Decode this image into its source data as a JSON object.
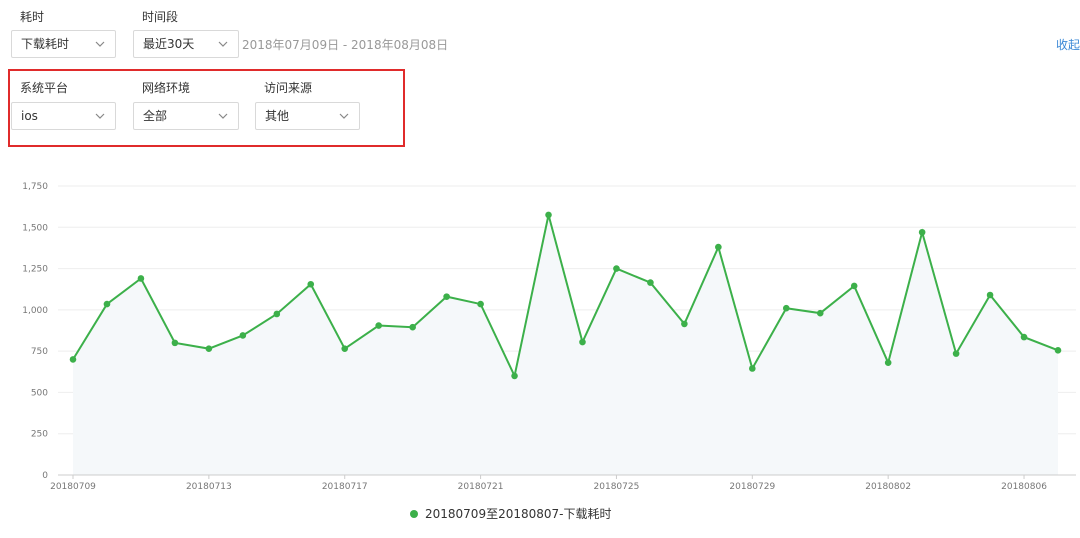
{
  "filters": {
    "duration": {
      "label": "耗时",
      "value": "下载耗时"
    },
    "period": {
      "label": "时间段",
      "value": "最近30天"
    },
    "date_range": "2018年07月09日 - 2018年08月08日",
    "collapse": "收起",
    "platform": {
      "label": "系统平台",
      "value": "ios"
    },
    "network": {
      "label": "网络环境",
      "value": "全部"
    },
    "source": {
      "label": "访问来源",
      "value": "其他"
    }
  },
  "icons": {
    "select_arrow": "chevron-down-icon"
  },
  "colors": {
    "series": "#3cb04a",
    "area": "#f5f8fa",
    "highlight_box": "#e02b2b",
    "link": "#3b88d6"
  },
  "chart_data": {
    "type": "line",
    "title": "",
    "xlabel": "",
    "ylabel": "",
    "x": [
      "20180709",
      "20180710",
      "20180711",
      "20180712",
      "20180713",
      "20180714",
      "20180715",
      "20180716",
      "20180717",
      "20180718",
      "20180719",
      "20180720",
      "20180721",
      "20180722",
      "20180723",
      "20180724",
      "20180725",
      "20180726",
      "20180727",
      "20180728",
      "20180729",
      "20180730",
      "20180731",
      "20180801",
      "20180802",
      "20180803",
      "20180804",
      "20180805",
      "20180806",
      "20180807"
    ],
    "x_tick_labels": [
      "20180709",
      "20180713",
      "20180717",
      "20180721",
      "20180725",
      "20180729",
      "20180802",
      "20180806"
    ],
    "y_ticks": [
      "0",
      "250",
      "500",
      "750",
      "1,000",
      "1,250",
      "1,500",
      "1,750"
    ],
    "ylim": [
      0,
      1750
    ],
    "grid": true,
    "legend_position": "bottom",
    "series": [
      {
        "name": "20180709至20180807-下载耗时",
        "values": [
          700,
          1035,
          1190,
          800,
          765,
          845,
          975,
          1155,
          765,
          905,
          895,
          1080,
          1035,
          600,
          1575,
          805,
          1250,
          1165,
          915,
          1380,
          645,
          1010,
          980,
          1145,
          680,
          1470,
          735,
          1090,
          835,
          755
        ]
      }
    ]
  }
}
